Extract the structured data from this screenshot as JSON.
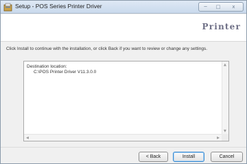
{
  "window": {
    "title": "Setup - POS Series Printer Driver",
    "controls": {
      "minimize": "─",
      "maximize": "□",
      "close": "x"
    }
  },
  "header": {
    "brand": "Printer"
  },
  "content": {
    "instructions": "Click Install to continue with the installation, or click Back if you want to review or change any settings.",
    "summary_label": "Destination location:",
    "summary_path": "C:\\POS Printer Driver V11.3.0.0"
  },
  "buttons": {
    "back": "< Back",
    "install": "Install",
    "cancel": "Cancel"
  },
  "colors": {
    "accent": "#3b8bd0",
    "brand": "#6e6f86"
  }
}
